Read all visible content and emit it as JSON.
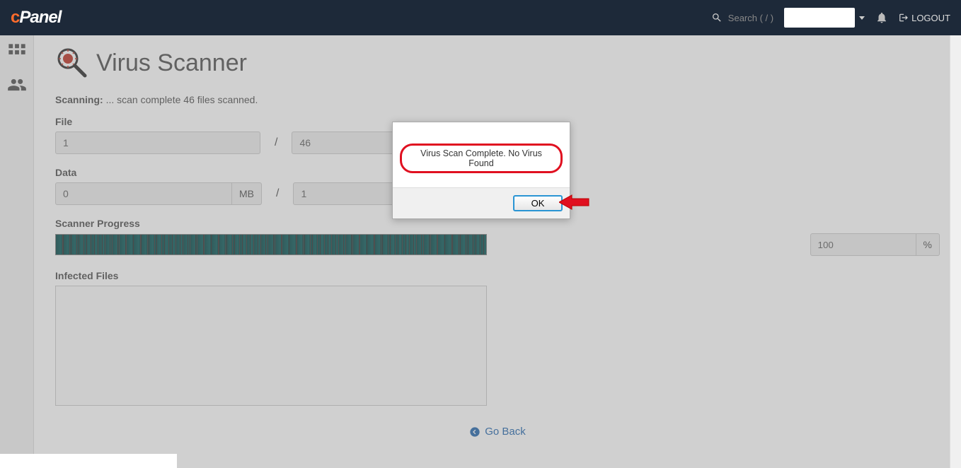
{
  "header": {
    "logo_text": "cPanel",
    "search_placeholder": "Search ( / )",
    "logout_label": "LOGOUT"
  },
  "page": {
    "title": "Virus Scanner",
    "scanning_prefix": "Scanning:",
    "scanning_status": "... scan complete 46 files scanned.",
    "file_label": "File",
    "file_current": "1",
    "file_total": "46",
    "data_label": "Data",
    "data_current": "0",
    "data_unit": "MB",
    "data_total": "1",
    "progress_label": "Scanner Progress",
    "progress_percent": "100",
    "percent_symbol": "%",
    "infected_label": "Infected Files",
    "go_back": "Go Back"
  },
  "modal": {
    "message": "Virus Scan Complete.  No Virus Found",
    "ok": "OK"
  }
}
